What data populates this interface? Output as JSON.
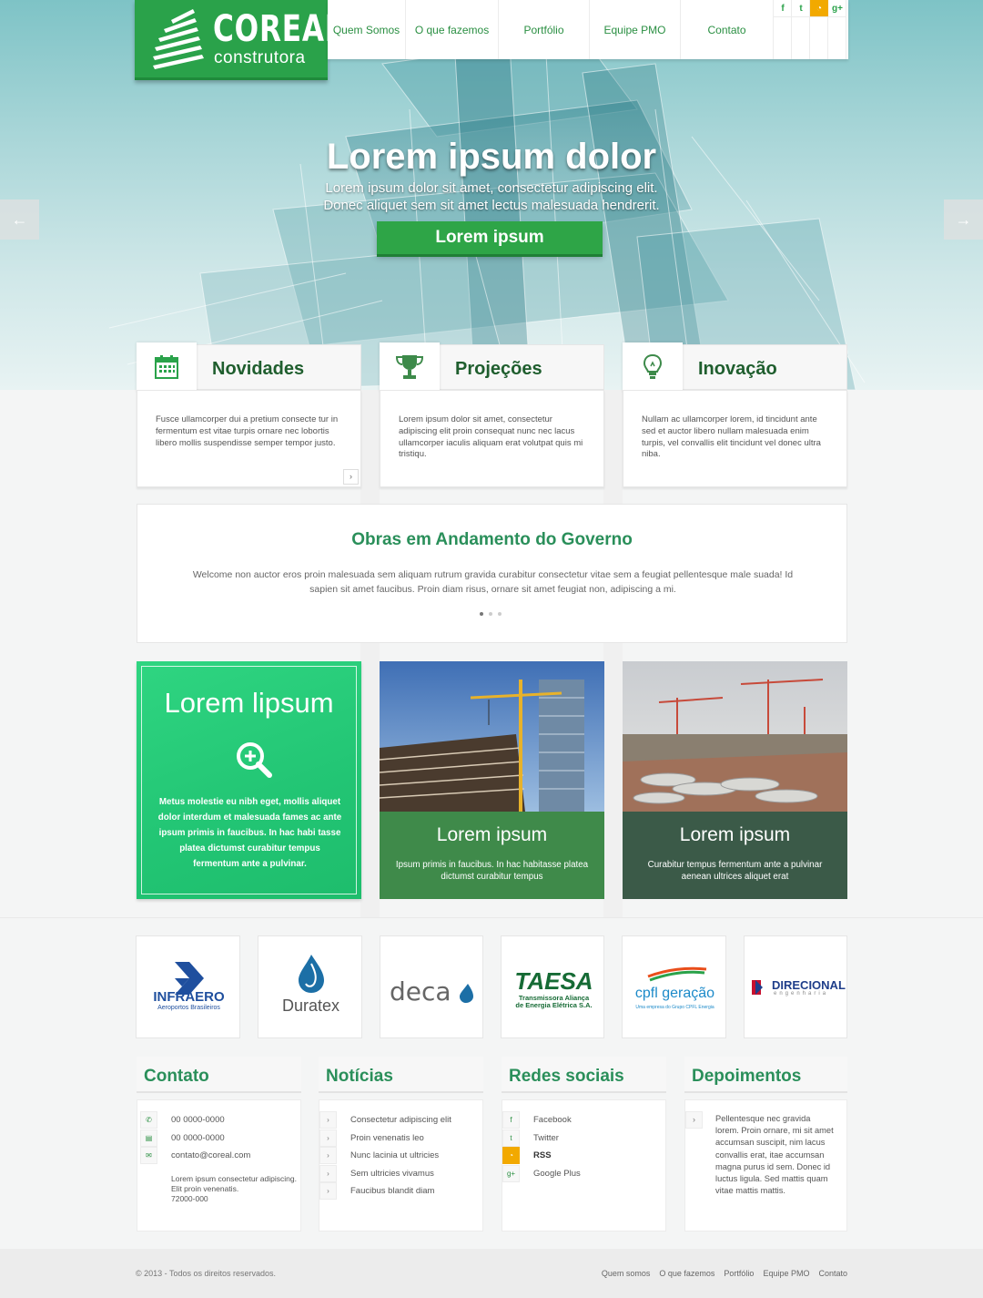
{
  "brand": {
    "name": "COREAL",
    "tagline": "construtora"
  },
  "nav": {
    "items": [
      {
        "label": "Quem Somos",
        "width": 86
      },
      {
        "label": "O que fazemos",
        "width": 102
      },
      {
        "label": "Portfólio",
        "width": 100
      },
      {
        "label": "Equipe PMO",
        "width": 100
      },
      {
        "label": "Contato",
        "width": 102
      }
    ],
    "social": [
      "f",
      "t",
      "rss",
      "g+"
    ]
  },
  "hero": {
    "title": "Lorem ipsum dolor",
    "line1": "Lorem ipsum dolor sit amet, consectetur adipiscing elit.",
    "line2": "Donec aliquet sem sit amet lectus malesuada hendrerit.",
    "button": "Lorem ipsum",
    "prev_icon": "arrow-left-icon",
    "next_icon": "arrow-right-icon"
  },
  "features": [
    {
      "title": "Novidades",
      "icon": "calendar-icon",
      "text": "Fusce ullamcorper dui a pretium consecte tur in fermentum est vitae turpis ornare nec lobortis libero mollis suspendisse semper tempor justo."
    },
    {
      "title": "Projeções",
      "icon": "trophy-icon",
      "text": "Lorem ipsum dolor sit amet, consectetur adipiscing elit proin consequat nunc nec lacus ullamcorper iaculis aliquam erat volutpat quis mi tristiqu."
    },
    {
      "title": "Inovação",
      "icon": "lightbulb-icon",
      "text": "Nullam ac ullamcorper lorem, id tincidunt ante sed et auctor libero nullam malesuada enim turpis, vel convallis elit tincidunt vel donec ultra niba."
    }
  ],
  "obras": {
    "title": "Obras em Andamento do Governo",
    "text": "Welcome non auctor eros proin malesuada sem aliquam rutrum gravida curabitur consectetur vitae sem a feugiat pellentesque male suada! Id sapien sit amet faucibus. Proin diam risus, ornare sit amet feugiat non, adipiscing a mi."
  },
  "portfolio": [
    {
      "title": "Lorem lipsum",
      "text": "Metus molestie eu nibh eget, mollis aliquet dolor interdum et malesuada fames ac ante ipsum primis in faucibus. In hac habi tasse platea dictumst curabitur tempus fermentum ante a pulvinar."
    },
    {
      "title": "Lorem ipsum",
      "text": "Ipsum primis in faucibus. In hac habitasse platea dictumst curabitur tempus"
    },
    {
      "title": "Lorem ipsum",
      "text": "Curabitur tempus fermentum ante a pulvinar aenean ultrices aliquet erat"
    }
  ],
  "clients": [
    {
      "name": "INFRAERO",
      "sub": "Aeroportos Brasileiros"
    },
    {
      "name": "Duratex"
    },
    {
      "name": "deca"
    },
    {
      "name": "TAESA",
      "sub": "Transmissora Aliança de Energia Elétrica S.A."
    },
    {
      "name": "cpfl geração",
      "sub": "Uma empresa do Grupo CPFL Energia"
    },
    {
      "name": "DIRECIONAL",
      "sub": "engenharia"
    }
  ],
  "footer": {
    "contato": {
      "title": "Contato",
      "phone": "00 0000-0000",
      "fax": "00 0000-0000",
      "email": "contato@coreal.com",
      "address_1": "Lorem ipsum consectetur adipiscing.",
      "address_2": "Elit proin venenatis.",
      "address_3": "72000-000"
    },
    "noticias": {
      "title": "Notícias",
      "items": [
        "Consectetur adipiscing elit",
        "Proin venenatis leo",
        "Nunc lacinia ut ultricies",
        "Sem ultricies vivamus",
        "Faucibus blandit diam"
      ]
    },
    "redes": {
      "title": "Redes sociais",
      "items": [
        "Facebook",
        "Twitter",
        "RSS",
        "Google Plus"
      ]
    },
    "depoimentos": {
      "title": "Depoimentos",
      "text": "Pellentesque nec gravida lorem. Proin ornare, mi sit amet accumsan suscipit, nim lacus convallis erat, itae accumsan magna purus id sem. Donec id luctus ligula. Sed mattis quam vitae mattis mattis."
    }
  },
  "bottom": {
    "copyright": "© 2013 - Todos os direitos reservados.",
    "links": [
      "Quem somos",
      "O que fazemos",
      "Portfólio",
      "Equipe PMO",
      "Contato"
    ]
  },
  "colors": {
    "primary": "#2aa24a",
    "heading": "#2a8f5a",
    "rss": "#f2a900",
    "tile_green": "#22c574",
    "tile_olive": "#3d8a4a",
    "tile_dark": "#3b5a48"
  }
}
